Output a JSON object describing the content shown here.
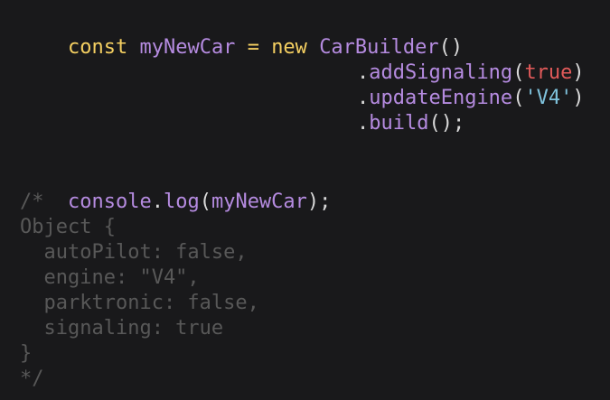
{
  "code": {
    "line1": {
      "kw_const": "const",
      "var_name": "myNewCar",
      "op_eq": "=",
      "kw_new": "new",
      "class_name": "CarBuilder",
      "parens": "()"
    },
    "line2": {
      "dot": ".",
      "method": "addSignaling",
      "open": "(",
      "arg": "true",
      "close": ")"
    },
    "line3": {
      "dot": ".",
      "method": "updateEngine",
      "open": "(",
      "arg": "'V4'",
      "close": ")"
    },
    "line4": {
      "dot": ".",
      "method": "build",
      "rest": "();"
    },
    "line5": {
      "console": "console",
      "dot": ".",
      "method": "log",
      "open": "(",
      "arg": "myNewCar",
      "close": ");"
    },
    "comment_lines": [
      "/*",
      "Object {",
      "  autoPilot: false,",
      "  engine: \"V4\",",
      "  parktronic: false,",
      "  signaling: true",
      "}",
      "*/"
    ]
  }
}
